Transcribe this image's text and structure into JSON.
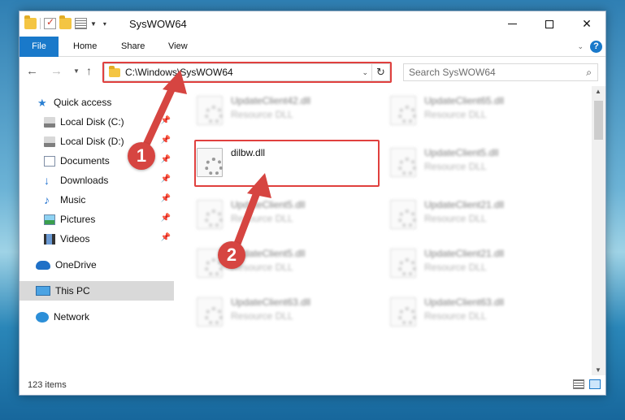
{
  "window": {
    "title": "SysWOW64"
  },
  "ribbon": {
    "tabs": [
      "File",
      "Home",
      "Share",
      "View"
    ],
    "help": "?"
  },
  "address": {
    "path": "C:\\Windows\\SysWOW64",
    "search_placeholder": "Search SysWOW64"
  },
  "nav": {
    "items": [
      {
        "label": "Quick access",
        "icon": "star-icon",
        "pinned": false
      },
      {
        "label": "Local Disk (C:)",
        "icon": "disk-icon",
        "pinned": true
      },
      {
        "label": "Local Disk (D:)",
        "icon": "disk-icon",
        "pinned": true
      },
      {
        "label": "Documents",
        "icon": "documents-icon",
        "pinned": true
      },
      {
        "label": "Downloads",
        "icon": "downloads-icon",
        "pinned": true
      },
      {
        "label": "Music",
        "icon": "music-icon",
        "pinned": true
      },
      {
        "label": "Pictures",
        "icon": "pictures-icon",
        "pinned": true
      },
      {
        "label": "Videos",
        "icon": "videos-icon",
        "pinned": true
      },
      {
        "label": "OneDrive",
        "icon": "onedrive-icon",
        "pinned": false
      },
      {
        "label": "This PC",
        "icon": "this-pc-icon",
        "pinned": false,
        "selected": true
      },
      {
        "label": "Network",
        "icon": "network-icon",
        "pinned": false
      }
    ]
  },
  "files": [
    {
      "name": "UpdateClient42.dll",
      "type": "Resource DLL",
      "blurred": true
    },
    {
      "name": "UpdateClient65.dll",
      "type": "Resource DLL",
      "blurred": true
    },
    {
      "name": "dilbw.dll",
      "type": "",
      "blurred": false
    },
    {
      "name": "UpdateClient5.dll",
      "type": "Resource DLL",
      "blurred": true
    },
    {
      "name": "UpdateClient5.dll",
      "type": "Resource DLL",
      "blurred": true
    },
    {
      "name": "UpdateClient21.dll",
      "type": "Resource DLL",
      "blurred": true
    },
    {
      "name": "UpdateClient5.dll",
      "type": "Resource DLL",
      "blurred": true
    },
    {
      "name": "UpdateClient21.dll",
      "type": "Resource DLL",
      "blurred": true
    },
    {
      "name": "UpdateClient63.dll",
      "type": "Resource DLL",
      "blurred": true
    },
    {
      "name": "UpdateClient63.dll",
      "type": "Resource DLL",
      "blurred": true
    }
  ],
  "status": {
    "item_count": "123 items"
  },
  "annotations": {
    "step1": "1",
    "step2": "2",
    "color": "#d64541"
  }
}
